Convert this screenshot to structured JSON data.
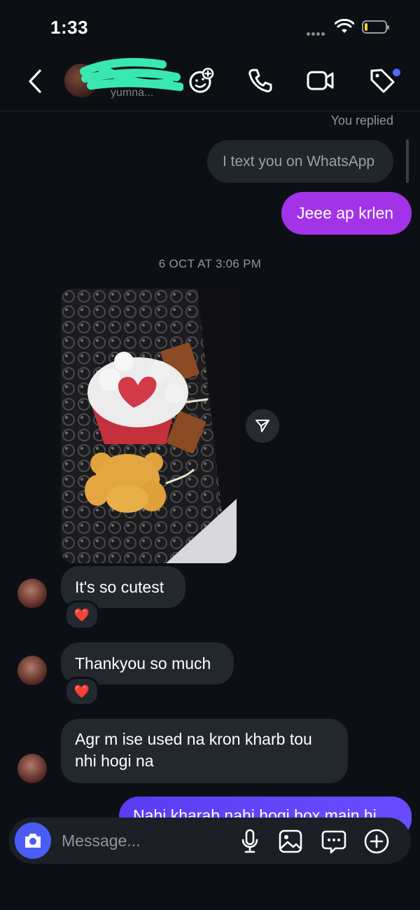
{
  "status_bar": {
    "time": "1:33"
  },
  "header": {
    "subtitle": "yumna..."
  },
  "messages": {
    "replied_label": "You replied",
    "quoted_text": "I text you on WhatsApp",
    "sent_reply": "Jeee ap krlen",
    "timestamp": "6 OCT AT 3:06 PM",
    "received": [
      {
        "text": "It's so cutest",
        "reaction": "❤️"
      },
      {
        "text": "Thankyou so much",
        "reaction": "❤️"
      },
      {
        "line1": "Agr m ise used na kron kharb tou",
        "line2": "nhi hogi na"
      }
    ],
    "sent_partial": "Nahi kharab nahi hogi box main hi"
  },
  "composer": {
    "placeholder": "Message..."
  },
  "colors": {
    "sent_bubble": "#a333e8",
    "sent_bubble_2": "#5b3cf0",
    "accent": "#4b5cf5"
  }
}
